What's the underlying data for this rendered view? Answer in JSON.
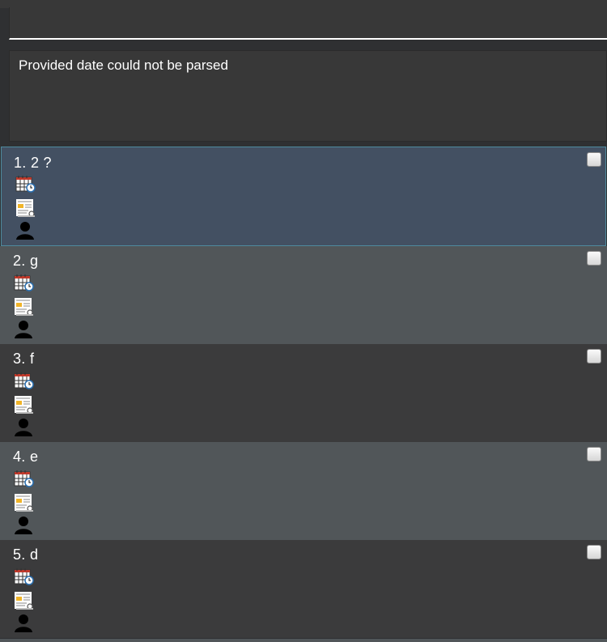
{
  "command": {
    "value": "",
    "placeholder": ""
  },
  "result": {
    "message": "Provided date could not be parsed"
  },
  "tasks": [
    {
      "index": "1.",
      "name": "2 ?",
      "checked": false,
      "selected": true
    },
    {
      "index": "2.",
      "name": "g",
      "checked": false,
      "selected": false
    },
    {
      "index": "3.",
      "name": "f",
      "checked": false,
      "selected": false
    },
    {
      "index": "4.",
      "name": "e",
      "checked": false,
      "selected": false
    },
    {
      "index": "5.",
      "name": "d",
      "checked": false,
      "selected": false
    }
  ],
  "colors": {
    "background": "#2f3032",
    "card_dark": "#3b3b3c",
    "card_grey": "#515659",
    "card_selected": "#435062",
    "selected_border": "#4e8a9e"
  },
  "icons": [
    "calendar-clock-icon",
    "document-icon",
    "person-icon"
  ]
}
